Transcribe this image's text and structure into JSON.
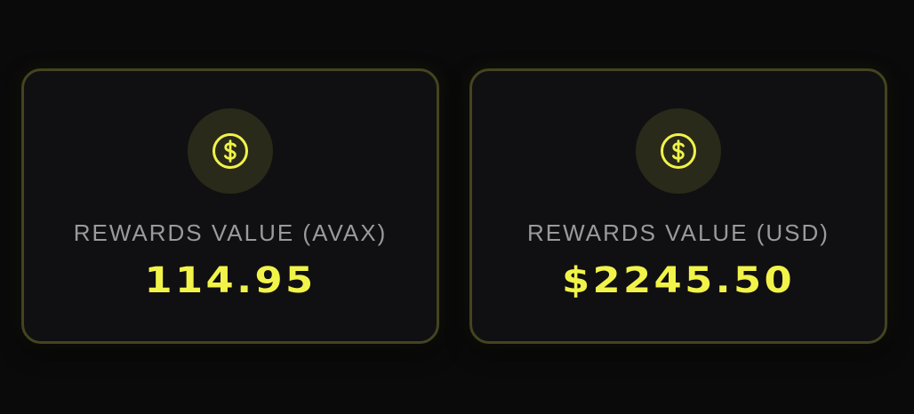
{
  "colors": {
    "accent": "#f1f34a",
    "card_border": "#444420",
    "card_background": "#101012",
    "label": "#9a9a9e",
    "icon_background": "#2a2a1a"
  },
  "cards": [
    {
      "icon": "dollar-coin-icon",
      "label": "REWARDS VALUE (AVAX)",
      "value": "114.95"
    },
    {
      "icon": "dollar-coin-icon",
      "label": "REWARDS VALUE (USD)",
      "value": "$2245.50"
    }
  ]
}
